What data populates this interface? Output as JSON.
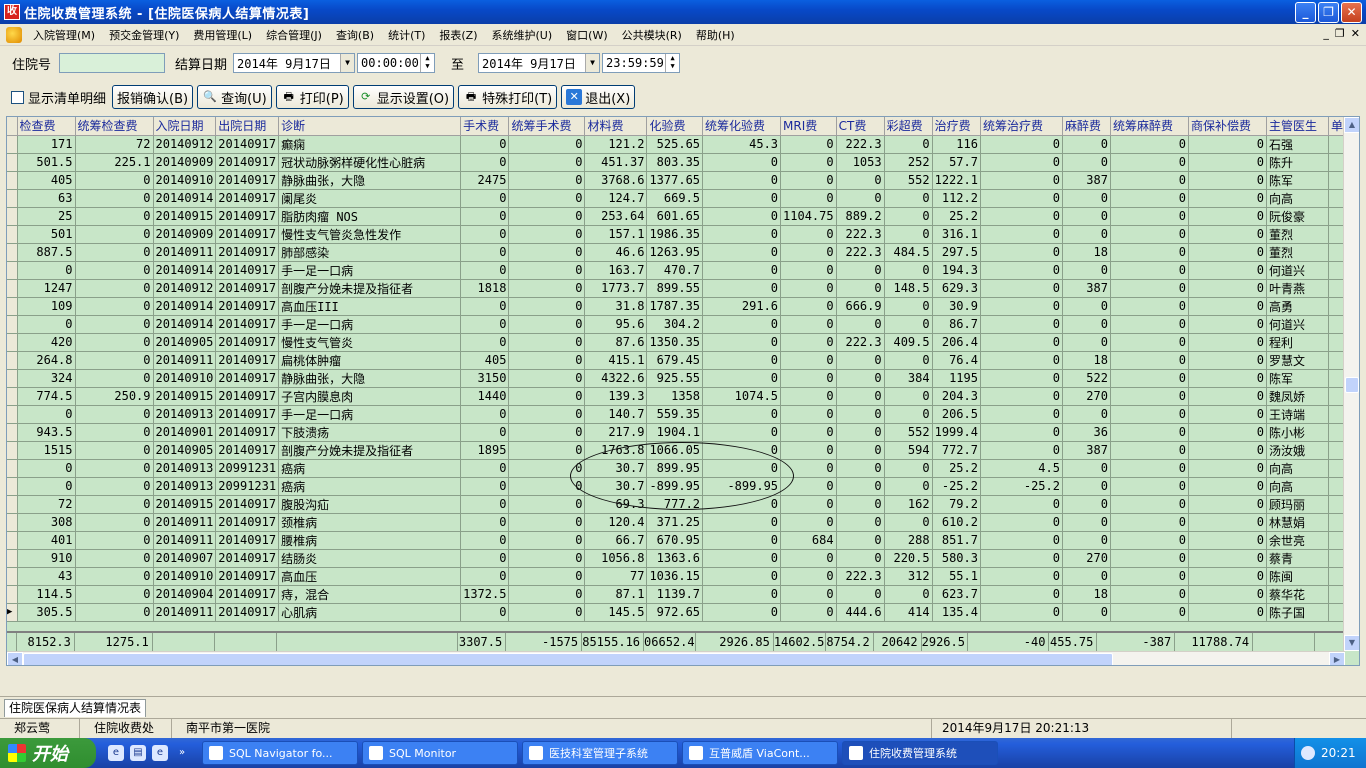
{
  "window": {
    "title": "住院收费管理系统 - [住院医保病人结算情况表]",
    "min": "_",
    "max": "❐",
    "close": "✕"
  },
  "menu": [
    "入院管理(M)",
    "预交金管理(Y)",
    "费用管理(L)",
    "综合管理(J)",
    "查询(B)",
    "统计(T)",
    "报表(Z)",
    "系统维护(U)",
    "窗口(W)",
    "公共模块(R)",
    "帮助(H)"
  ],
  "mdi": {
    "min": "_",
    "restore": "❐",
    "close": "✕"
  },
  "filters": {
    "inpatient_no_label": "住院号",
    "inpatient_no_value": "",
    "settle_date_label": "结算日期",
    "start_date": "2014年 9月17日",
    "start_time": "00:00:00",
    "to_label": "至",
    "end_date": "2014年 9月17日",
    "end_time": "23:59:59"
  },
  "toolbar": {
    "show_detail": "显示清单明细",
    "confirm_cancel": "报销确认(B)",
    "query": "查询(U)",
    "print": "打印(P)",
    "display_settings": "显示设置(O)",
    "special_print": "特殊打印(T)",
    "exit": "退出(X)"
  },
  "grid": {
    "columns": [
      "检查费",
      "统筹检查费",
      "入院日期",
      "出院日期",
      "诊断",
      "手术费",
      "统筹手术费",
      "材料费",
      "化验费",
      "统筹化验费",
      "MRI费",
      "CT费",
      "彩超费",
      "治疗费",
      "统筹治疗费",
      "麻醉费",
      "统筹麻醉费",
      "商保补偿费",
      "主管医生",
      "单病"
    ],
    "rows": [
      [
        "171",
        "72",
        "20140912",
        "20140917",
        "癫痫",
        "0",
        "0",
        "121.2",
        "525.65",
        "45.3",
        "0",
        "222.3",
        "0",
        "116",
        "0",
        "0",
        "0",
        "0",
        "石强",
        ""
      ],
      [
        "501.5",
        "225.1",
        "20140909",
        "20140917",
        "冠状动脉粥样硬化性心脏病",
        "0",
        "0",
        "451.37",
        "803.35",
        "0",
        "0",
        "1053",
        "252",
        "57.7",
        "0",
        "0",
        "0",
        "0",
        "陈升",
        ""
      ],
      [
        "405",
        "0",
        "20140910",
        "20140917",
        "静脉曲张，大隐",
        "2475",
        "0",
        "3768.6",
        "1377.65",
        "0",
        "0",
        "0",
        "552",
        "1222.1",
        "0",
        "387",
        "0",
        "0",
        "陈军",
        ""
      ],
      [
        "63",
        "0",
        "20140914",
        "20140917",
        "阑尾炎",
        "0",
        "0",
        "124.7",
        "669.5",
        "0",
        "0",
        "0",
        "0",
        "112.2",
        "0",
        "0",
        "0",
        "0",
        "向高",
        ""
      ],
      [
        "25",
        "0",
        "20140915",
        "20140917",
        "脂肪肉瘤 NOS",
        "0",
        "0",
        "253.64",
        "601.65",
        "0",
        "1104.75",
        "889.2",
        "0",
        "25.2",
        "0",
        "0",
        "0",
        "0",
        "阮俊豪",
        ""
      ],
      [
        "501",
        "0",
        "20140909",
        "20140917",
        "慢性支气管炎急性发作",
        "0",
        "0",
        "157.1",
        "1986.35",
        "0",
        "0",
        "222.3",
        "0",
        "316.1",
        "0",
        "0",
        "0",
        "0",
        "董烈",
        ""
      ],
      [
        "887.5",
        "0",
        "20140911",
        "20140917",
        "肺部感染",
        "0",
        "0",
        "46.6",
        "1263.95",
        "0",
        "0",
        "222.3",
        "484.5",
        "297.5",
        "0",
        "18",
        "0",
        "0",
        "董烈",
        ""
      ],
      [
        "0",
        "0",
        "20140914",
        "20140917",
        "手一足一口病",
        "0",
        "0",
        "163.7",
        "470.7",
        "0",
        "0",
        "0",
        "0",
        "194.3",
        "0",
        "0",
        "0",
        "0",
        "何道兴",
        ""
      ],
      [
        "1247",
        "0",
        "20140912",
        "20140917",
        "剖腹产分娩未提及指征者",
        "1818",
        "0",
        "1773.7",
        "899.55",
        "0",
        "0",
        "0",
        "148.5",
        "629.3",
        "0",
        "387",
        "0",
        "0",
        "叶青燕",
        ""
      ],
      [
        "109",
        "0",
        "20140914",
        "20140917",
        "高血压III",
        "0",
        "0",
        "31.8",
        "1787.35",
        "291.6",
        "0",
        "666.9",
        "0",
        "30.9",
        "0",
        "0",
        "0",
        "0",
        "高勇",
        ""
      ],
      [
        "0",
        "0",
        "20140914",
        "20140917",
        "手一足一口病",
        "0",
        "0",
        "95.6",
        "304.2",
        "0",
        "0",
        "0",
        "0",
        "86.7",
        "0",
        "0",
        "0",
        "0",
        "何道兴",
        ""
      ],
      [
        "420",
        "0",
        "20140905",
        "20140917",
        "慢性支气管炎",
        "0",
        "0",
        "87.6",
        "1350.35",
        "0",
        "0",
        "222.3",
        "409.5",
        "206.4",
        "0",
        "0",
        "0",
        "0",
        "程利",
        ""
      ],
      [
        "264.8",
        "0",
        "20140911",
        "20140917",
        "扁桃体肿瘤",
        "405",
        "0",
        "415.1",
        "679.45",
        "0",
        "0",
        "0",
        "0",
        "76.4",
        "0",
        "18",
        "0",
        "0",
        "罗慧文",
        ""
      ],
      [
        "324",
        "0",
        "20140910",
        "20140917",
        "静脉曲张，大隐",
        "3150",
        "0",
        "4322.6",
        "925.55",
        "0",
        "0",
        "0",
        "384",
        "1195",
        "0",
        "522",
        "0",
        "0",
        "陈军",
        ""
      ],
      [
        "774.5",
        "250.9",
        "20140915",
        "20140917",
        "子宫内膜息肉",
        "1440",
        "0",
        "139.3",
        "1358",
        "1074.5",
        "0",
        "0",
        "0",
        "204.3",
        "0",
        "270",
        "0",
        "0",
        "魏凤娇",
        ""
      ],
      [
        "0",
        "0",
        "20140913",
        "20140917",
        "手一足一口病",
        "0",
        "0",
        "140.7",
        "559.35",
        "0",
        "0",
        "0",
        "0",
        "206.5",
        "0",
        "0",
        "0",
        "0",
        "王诗端",
        ""
      ],
      [
        "943.5",
        "0",
        "20140901",
        "20140917",
        "下肢溃疡",
        "0",
        "0",
        "217.9",
        "1904.1",
        "0",
        "0",
        "0",
        "552",
        "1999.4",
        "0",
        "36",
        "0",
        "0",
        "陈小彬",
        ""
      ],
      [
        "1515",
        "0",
        "20140905",
        "20140917",
        "剖腹产分娩未提及指征者",
        "1895",
        "0",
        "1763.8",
        "1066.05",
        "0",
        "0",
        "0",
        "594",
        "772.7",
        "0",
        "387",
        "0",
        "0",
        "汤汝娥",
        ""
      ],
      [
        "0",
        "0",
        "20140913",
        "20991231",
        "癌病",
        "0",
        "0",
        "30.7",
        "899.95",
        "0",
        "0",
        "0",
        "0",
        "25.2",
        "4.5",
        "0",
        "0",
        "0",
        "向高",
        ""
      ],
      [
        "0",
        "0",
        "20140913",
        "20991231",
        "癌病",
        "0",
        "0",
        "30.7",
        "-899.95",
        "-899.95",
        "0",
        "0",
        "0",
        "-25.2",
        "-25.2",
        "0",
        "0",
        "0",
        "向高",
        ""
      ],
      [
        "72",
        "0",
        "20140915",
        "20140917",
        "腹股沟疝",
        "0",
        "0",
        "69.3",
        "777.2",
        "0",
        "0",
        "0",
        "162",
        "79.2",
        "0",
        "0",
        "0",
        "0",
        "顾玛丽",
        ""
      ],
      [
        "308",
        "0",
        "20140911",
        "20140917",
        "颈椎病",
        "0",
        "0",
        "120.4",
        "371.25",
        "0",
        "0",
        "0",
        "0",
        "610.2",
        "0",
        "0",
        "0",
        "0",
        "林慧娟",
        ""
      ],
      [
        "401",
        "0",
        "20140911",
        "20140917",
        "腰椎病",
        "0",
        "0",
        "66.7",
        "670.95",
        "0",
        "684",
        "0",
        "288",
        "851.7",
        "0",
        "0",
        "0",
        "0",
        "余世亮",
        ""
      ],
      [
        "910",
        "0",
        "20140907",
        "20140917",
        "结肠炎",
        "0",
        "0",
        "1056.8",
        "1363.6",
        "0",
        "0",
        "0",
        "220.5",
        "580.3",
        "0",
        "270",
        "0",
        "0",
        "蔡青",
        ""
      ],
      [
        "43",
        "0",
        "20140910",
        "20140917",
        "高血压",
        "0",
        "0",
        "77",
        "1036.15",
        "0",
        "0",
        "222.3",
        "312",
        "55.1",
        "0",
        "0",
        "0",
        "0",
        "陈闽",
        ""
      ],
      [
        "114.5",
        "0",
        "20140904",
        "20140917",
        "痔，混合",
        "1372.5",
        "0",
        "87.1",
        "1139.7",
        "0",
        "0",
        "0",
        "0",
        "623.7",
        "0",
        "18",
        "0",
        "0",
        "蔡华花",
        ""
      ],
      [
        "305.5",
        "0",
        "20140911",
        "20140917",
        "心肌病",
        "0",
        "0",
        "145.5",
        "972.65",
        "0",
        "0",
        "444.6",
        "414",
        "135.4",
        "0",
        "0",
        "0",
        "0",
        "陈子国",
        ""
      ]
    ],
    "totals": [
      "8152.3",
      "1275.1",
      "",
      "",
      "",
      "3307.5",
      "-1575",
      "85155.16",
      "06652.4",
      "2926.85",
      "14602.5",
      "8754.2",
      "20642",
      "2926.5",
      "-40",
      "455.75",
      "-387",
      "11788.74",
      "",
      ""
    ]
  },
  "tab": "住院医保病人结算情况表",
  "status": {
    "user": "郑云莺",
    "dept": "住院收费处",
    "hospital": "南平市第一医院",
    "datetime": "2014年9月17日  20:21:13"
  },
  "taskbar": {
    "start": "开始",
    "tasks": [
      "SQL Navigator fo...",
      "SQL Monitor",
      "医技科室管理子系统",
      "互普威盾 ViaCont...",
      "住院收费管理系统"
    ],
    "clock": "20:21"
  }
}
